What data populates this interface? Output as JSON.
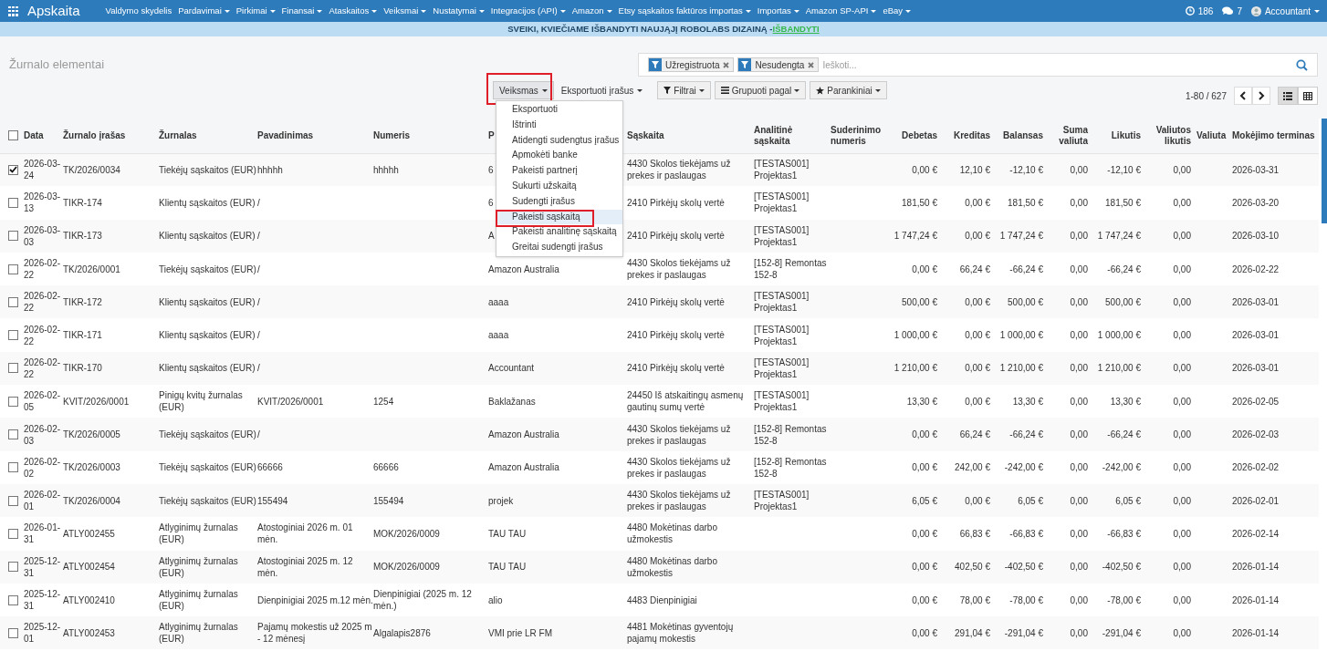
{
  "navbar": {
    "brand": "Apskaita",
    "items": [
      {
        "label": "Valdymo skydelis",
        "dropdown": false
      },
      {
        "label": "Pardavimai",
        "dropdown": true
      },
      {
        "label": "Pirkimai",
        "dropdown": true
      },
      {
        "label": "Finansai",
        "dropdown": true
      },
      {
        "label": "Ataskaitos",
        "dropdown": true
      },
      {
        "label": "Veiksmai",
        "dropdown": true
      },
      {
        "label": "Nustatymai",
        "dropdown": true
      },
      {
        "label": "Integracijos (API)",
        "dropdown": true
      },
      {
        "label": "Amazon",
        "dropdown": true
      },
      {
        "label": "Etsy sąskaitos faktūros importas",
        "dropdown": true
      },
      {
        "label": "Importas",
        "dropdown": true
      },
      {
        "label": "Amazon SP-API",
        "dropdown": true
      },
      {
        "label": "eBay",
        "dropdown": true
      }
    ],
    "activity_count": "186",
    "message_count": "7",
    "user": "Accountant"
  },
  "banner": {
    "text": "SVEIKI, KVIEČIAME IŠBANDYTI NAUJĄJĮ ROBOLABS DIZAINĄ - ",
    "link": "IŠBANDYTI"
  },
  "title": "Žurnalo elementai",
  "search": {
    "facets": [
      "Užregistruota",
      "Nesudengta"
    ],
    "placeholder": "Ieškoti..."
  },
  "actions_button": "Veiksmas",
  "export_button": "Eksportuoti įrašus",
  "filter_buttons": [
    "Filtrai",
    "Grupuoti pagal",
    "Parankiniai"
  ],
  "pager": "1-80 / 627",
  "views": [
    {
      "kind": "list",
      "selected": true
    },
    {
      "kind": "grid",
      "selected": false
    }
  ],
  "actions_menu": [
    {
      "label": "Eksportuoti",
      "selected": false
    },
    {
      "label": "Ištrinti",
      "selected": false
    },
    {
      "label": "Atidengti sudengtus įrašus",
      "selected": false
    },
    {
      "label": "Apmokėti banke",
      "selected": false
    },
    {
      "label": "Pakeisti partnerį",
      "selected": false
    },
    {
      "label": "Sukurti užskaitą",
      "selected": false
    },
    {
      "label": "Sudengti įrašus",
      "selected": false
    },
    {
      "label": "Pakeisti sąskaitą",
      "selected": true
    },
    {
      "label": "Pakeisti analitinę sąskaitą",
      "selected": false
    },
    {
      "label": "Greitai sudengti įrašus",
      "selected": false
    }
  ],
  "table": {
    "all_checked": false,
    "columns": [
      "Data",
      "Žurnalo įrašas",
      "Žurnalas",
      "Pavadinimas",
      "Numeris",
      "P",
      "Sąskaita",
      "Analitinė sąskaita",
      "Suderinimo numeris",
      "Debetas",
      "Kreditas",
      "Balansas",
      "Suma valiuta",
      "Likutis",
      "Valiutos likutis",
      "Valiuta",
      "Mokėjimo terminas"
    ],
    "rows": [
      {
        "checked": true,
        "date": "2026-03-24",
        "entry": "TK/2026/0034",
        "journal": "Tiekėjų sąskaitos (EUR)",
        "name": "hhhhh",
        "number": "hhhhh",
        "partner": "6",
        "account": "4430 Skolos tiekėjams už prekes ir paslaugas",
        "analytic": "[TESTAS001] Projektas1",
        "debit": "0,00 €",
        "credit": "12,10 €",
        "balance": "-12,10 €",
        "amount_currency": "0,00",
        "residual": "-12,10 €",
        "currency_residual": "0,00",
        "due": "2026-03-31"
      },
      {
        "checked": false,
        "date": "2026-03-13",
        "entry": "TIKR-174",
        "journal": "Klientų sąskaitos (EUR)",
        "name": "/",
        "partner": "6",
        "account": "2410 Pirkėjų skolų vertė",
        "analytic": "[TESTAS001] Projektas1",
        "debit": "181,50 €",
        "credit": "0,00 €",
        "balance": "181,50 €",
        "amount_currency": "0,00",
        "residual": "181,50 €",
        "currency_residual": "0,00",
        "due": "2026-03-20"
      },
      {
        "checked": false,
        "date": "2026-03-03",
        "entry": "TIKR-173",
        "journal": "Klientų sąskaitos (EUR)",
        "name": "/",
        "partner": "A",
        "account": "2410 Pirkėjų skolų vertė",
        "analytic": "[TESTAS001] Projektas1",
        "debit": "1 747,24 €",
        "credit": "0,00 €",
        "balance": "1 747,24 €",
        "amount_currency": "0,00",
        "residual": "1 747,24 €",
        "currency_residual": "0,00",
        "due": "2026-03-10"
      },
      {
        "checked": false,
        "date": "2026-02-22",
        "entry": "TK/2026/0001",
        "journal": "Tiekėjų sąskaitos (EUR)",
        "name": "/",
        "partner": "Amazon Australia",
        "account": "4430 Skolos tiekėjams už prekes ir paslaugas",
        "analytic": "[152-8] Remontas 152-8",
        "debit": "0,00 €",
        "credit": "66,24 €",
        "balance": "-66,24 €",
        "amount_currency": "0,00",
        "residual": "-66,24 €",
        "currency_residual": "0,00",
        "due": "2026-02-22"
      },
      {
        "checked": false,
        "date": "2026-02-22",
        "entry": "TIKR-172",
        "journal": "Klientų sąskaitos (EUR)",
        "name": "/",
        "partner": "aaaa",
        "account": "2410 Pirkėjų skolų vertė",
        "analytic": "[TESTAS001] Projektas1",
        "debit": "500,00 €",
        "credit": "0,00 €",
        "balance": "500,00 €",
        "amount_currency": "0,00",
        "residual": "500,00 €",
        "currency_residual": "0,00",
        "due": "2026-03-01"
      },
      {
        "checked": false,
        "date": "2026-02-22",
        "entry": "TIKR-171",
        "journal": "Klientų sąskaitos (EUR)",
        "name": "/",
        "partner": "aaaa",
        "account": "2410 Pirkėjų skolų vertė",
        "analytic": "[TESTAS001] Projektas1",
        "debit": "1 000,00 €",
        "credit": "0,00 €",
        "balance": "1 000,00 €",
        "amount_currency": "0,00",
        "residual": "1 000,00 €",
        "currency_residual": "0,00",
        "due": "2026-03-01"
      },
      {
        "checked": false,
        "date": "2026-02-22",
        "entry": "TIKR-170",
        "journal": "Klientų sąskaitos (EUR)",
        "name": "/",
        "partner": "Accountant",
        "account": "2410 Pirkėjų skolų vertė",
        "analytic": "[TESTAS001] Projektas1",
        "debit": "1 210,00 €",
        "credit": "0,00 €",
        "balance": "1 210,00 €",
        "amount_currency": "0,00",
        "residual": "1 210,00 €",
        "currency_residual": "0,00",
        "due": "2026-03-01"
      },
      {
        "checked": false,
        "date": "2026-02-05",
        "entry": "KVIT/2026/0001",
        "journal": "Pinigų kvitų žurnalas (EUR)",
        "name": "KVIT/2026/0001",
        "number": "1254",
        "partner": "Baklažanas",
        "account": "24450 Iš atskaitingų asmenų gautinų sumų vertė",
        "analytic": "[TESTAS001] Projektas1",
        "debit": "13,30 €",
        "credit": "0,00 €",
        "balance": "13,30 €",
        "amount_currency": "0,00",
        "residual": "13,30 €",
        "currency_residual": "0,00",
        "due": "2026-02-05"
      },
      {
        "checked": false,
        "date": "2026-02-03",
        "entry": "TK/2026/0005",
        "journal": "Tiekėjų sąskaitos (EUR)",
        "name": "/",
        "partner": "Amazon Australia",
        "account": "4430 Skolos tiekėjams už prekes ir paslaugas",
        "analytic": "[152-8] Remontas 152-8",
        "debit": "0,00 €",
        "credit": "66,24 €",
        "balance": "-66,24 €",
        "amount_currency": "0,00",
        "residual": "-66,24 €",
        "currency_residual": "0,00",
        "due": "2026-02-03"
      },
      {
        "checked": false,
        "date": "2026-02-02",
        "entry": "TK/2026/0003",
        "journal": "Tiekėjų sąskaitos (EUR)",
        "name": "66666",
        "number": "66666",
        "partner": "Amazon Australia",
        "account": "4430 Skolos tiekėjams už prekes ir paslaugas",
        "analytic": "[152-8] Remontas 152-8",
        "debit": "0,00 €",
        "credit": "242,00 €",
        "balance": "-242,00 €",
        "amount_currency": "0,00",
        "residual": "-242,00 €",
        "currency_residual": "0,00",
        "due": "2026-02-02"
      },
      {
        "checked": false,
        "date": "2026-02-01",
        "entry": "TK/2026/0004",
        "journal": "Tiekėjų sąskaitos (EUR)",
        "name": "155494",
        "number": "155494",
        "partner": "projek",
        "account": "4430 Skolos tiekėjams už prekes ir paslaugas",
        "analytic": "[TESTAS001] Projektas1",
        "debit": "6,05 €",
        "credit": "0,00 €",
        "balance": "6,05 €",
        "amount_currency": "0,00",
        "residual": "6,05 €",
        "currency_residual": "0,00",
        "due": "2026-02-01"
      },
      {
        "checked": false,
        "date": "2026-01-31",
        "entry": "ATLY002455",
        "journal": "Atlyginimų žurnalas (EUR)",
        "name": "Atostoginiai 2026 m. 01 mėn.",
        "number": "MOK/2026/0009",
        "partner": "TAU TAU",
        "account": "4480 Mokėtinas darbo užmokestis",
        "debit": "0,00 €",
        "credit": "66,83 €",
        "balance": "-66,83 €",
        "amount_currency": "0,00",
        "residual": "-66,83 €",
        "currency_residual": "0,00",
        "due": "2026-02-14"
      },
      {
        "checked": false,
        "date": "2025-12-31",
        "entry": "ATLY002454",
        "journal": "Atlyginimų žurnalas (EUR)",
        "name": "Atostoginiai 2025 m. 12 mėn.",
        "number": "MOK/2026/0009",
        "partner": "TAU TAU",
        "account": "4480 Mokėtinas darbo užmokestis",
        "debit": "0,00 €",
        "credit": "402,50 €",
        "balance": "-402,50 €",
        "amount_currency": "0,00",
        "residual": "-402,50 €",
        "currency_residual": "0,00",
        "due": "2026-01-14"
      },
      {
        "checked": false,
        "date": "2025-12-31",
        "entry": "ATLY002410",
        "journal": "Atlyginimų žurnalas (EUR)",
        "name": "Dienpinigiai 2025 m.12 mėn.",
        "number": "Dienpinigiai (2025 m. 12 mėn.)",
        "partner": "alio",
        "account": "4483 Dienpinigiai",
        "debit": "0,00 €",
        "credit": "78,00 €",
        "balance": "-78,00 €",
        "amount_currency": "0,00",
        "residual": "-78,00 €",
        "currency_residual": "0,00",
        "due": "2026-01-14"
      },
      {
        "checked": false,
        "date": "2025-12-01",
        "entry": "ATLY002453",
        "journal": "Atlyginimų žurnalas (EUR)",
        "name": "Pajamų mokestis už 2025 m - 12 mėnesį",
        "number": "Algalapis2876",
        "partner": "VMI prie LR FM",
        "account": "4481 Mokėtinas gyventojų pajamų mokestis",
        "debit": "0,00 €",
        "credit": "291,04 €",
        "balance": "-291,04 €",
        "amount_currency": "0,00",
        "residual": "-291,04 €",
        "currency_residual": "0,00",
        "due": "2026-01-14"
      }
    ]
  }
}
